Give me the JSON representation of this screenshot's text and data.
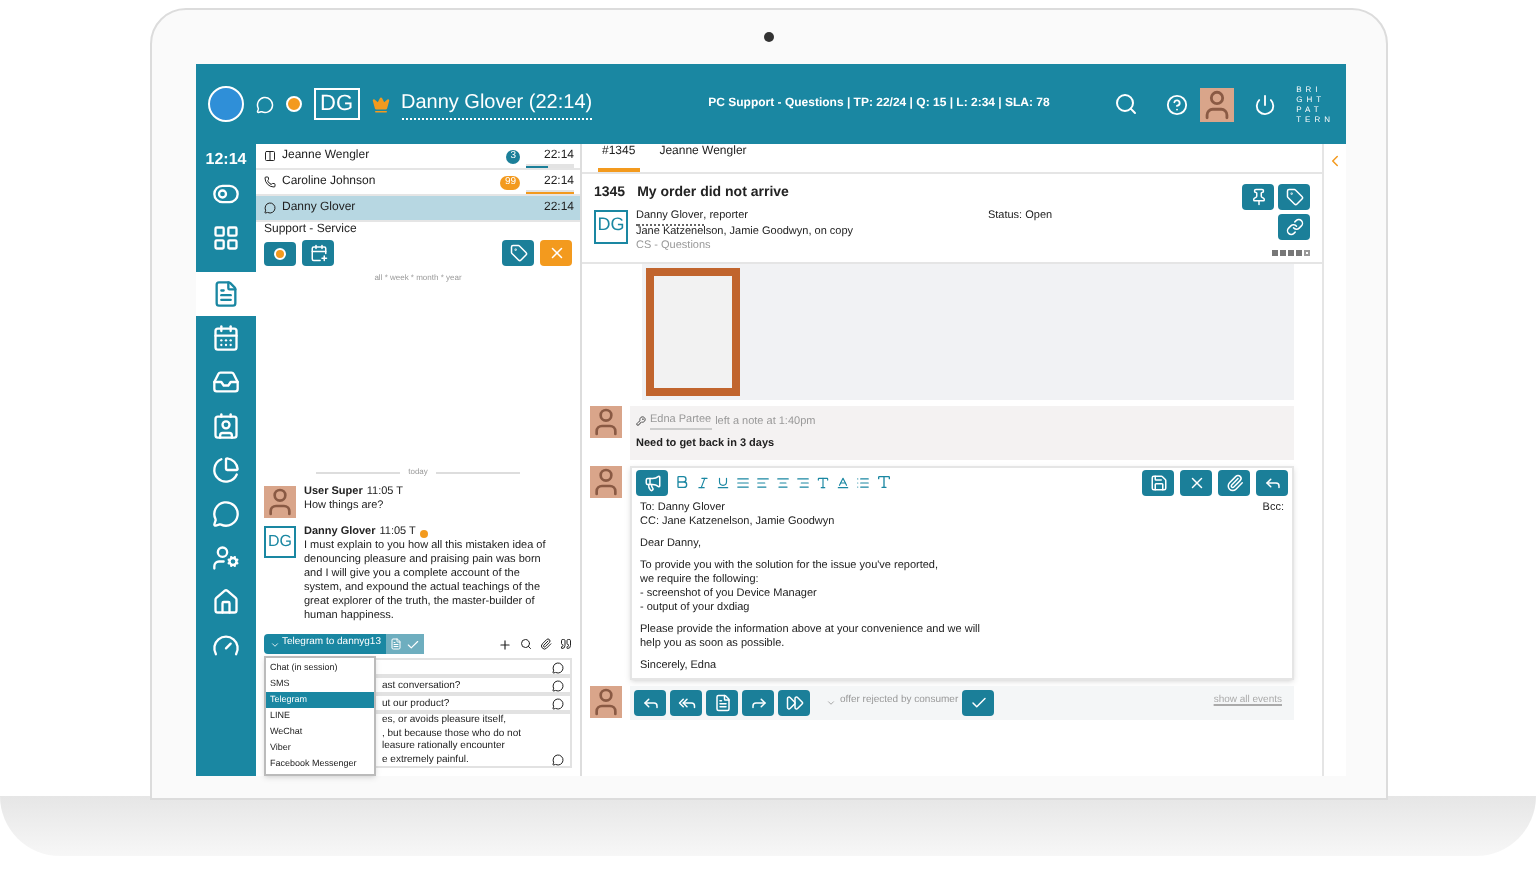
{
  "topbar": {
    "initials": "DG",
    "contact": "Danny Glover (22:14)",
    "stats": "PC Support - Questions | TP: 22/24 | Q: 15 | L: 2:34 | SLA: 78",
    "logo": [
      "BRI",
      "GHT",
      "PAT",
      "TERN"
    ]
  },
  "sidebar": {
    "time": "12:14",
    "items": [
      {
        "kind": "toggle",
        "selected": false
      },
      {
        "kind": "grid",
        "selected": false
      },
      {
        "kind": "documents",
        "selected": true
      },
      {
        "kind": "calendar",
        "selected": false
      },
      {
        "kind": "inbox",
        "selected": false
      },
      {
        "kind": "contact",
        "selected": false
      },
      {
        "kind": "pie",
        "selected": false
      },
      {
        "kind": "chat",
        "selected": false
      },
      {
        "kind": "user-settings",
        "selected": false
      },
      {
        "kind": "home",
        "selected": false
      },
      {
        "kind": "gauge",
        "selected": false
      }
    ]
  },
  "conversations": [
    {
      "kind": "split",
      "name": "Jeanne Wengler",
      "badge": "3",
      "color": "#1b7f99",
      "time": "22:14",
      "level": 0.45,
      "selected": false
    },
    {
      "kind": "phone",
      "name": "Caroline Johnson",
      "badge": "99",
      "color": "#f39a1e",
      "time": "22:14",
      "level": 1,
      "selected": false
    },
    {
      "kind": "chat",
      "name": "Danny Glover",
      "time": "22:14",
      "selected": true
    }
  ],
  "queue": {
    "label": "Support - Service",
    "filter": "all * week * month * year"
  },
  "divider": "today",
  "messages": [
    {
      "kind": "photo",
      "author": "User Super",
      "time": "11:05 T",
      "text": "How things are?"
    },
    {
      "kind": "initials",
      "initials": "DG",
      "author": "Danny Glover",
      "time": "11:05 T",
      "text": "I must explain to you how all this mistaken idea of denouncing pleasure and praising pain was born and I will give you a complete account of the system, and expound the actual teachings of the great explorer of the truth, the master-builder of human happiness.",
      "flag": true
    }
  ],
  "composer": {
    "channel": "Telegram to dannyg13",
    "options": [
      {
        "label": "Chat (in session)",
        "selected": false
      },
      {
        "label": "SMS",
        "selected": false
      },
      {
        "label": "Telegram",
        "selected": true
      },
      {
        "label": "LINE",
        "selected": false
      },
      {
        "label": "WeChat",
        "selected": false
      },
      {
        "label": "Viber",
        "selected": false
      },
      {
        "label": "Facebook Messenger",
        "selected": false
      }
    ],
    "templates": [
      "ast conversation?",
      "ut our product?",
      "es, or avoids pleasure itself,\n, but because those who do not\nleasure rationally encounter\ne extremely painful."
    ]
  },
  "tabs": [
    {
      "label": "#1345",
      "selected": true
    },
    {
      "label": "Jeanne Wengler",
      "selected": false
    }
  ],
  "ticket": {
    "number": "1345",
    "title": "My order did not arrive",
    "initials": "DG",
    "reporter": "Danny Glover",
    "reporter_role": ", reporter",
    "copy": "Jane Katzenelson, Jamie Goodwyn, on copy",
    "queue": "CS - Questions",
    "status": "Status: Open",
    "stars": 4
  },
  "note": {
    "author": "Edna Partee",
    "action": "left a note at 1:40pm",
    "text": "Need to get back in 3 days"
  },
  "email": {
    "to": "To: Danny Glover",
    "cc": "CC: Jane Katzenelson, Jamie Goodwyn",
    "bcc": "Bcc:",
    "paragraphs": [
      "Dear Danny,",
      "To provide you with the solution for the issue you've reported,\nwe require the following:\n- screenshot of you Device Manager\n- output of your dxdiag",
      "Please provide the information above at your convenience and we will\nhelp you as soon as possible.",
      "Sincerely, Edna"
    ]
  },
  "footer": {
    "outcome": "offer rejected by consumer",
    "link": "show all events"
  }
}
